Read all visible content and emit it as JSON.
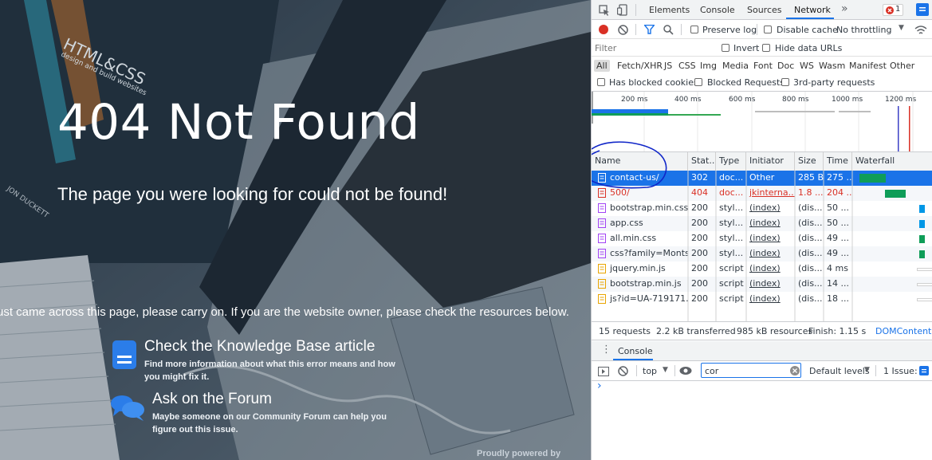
{
  "page": {
    "heading": "404 Not Found",
    "subheading": "The page you were looking for could not be found!",
    "message": "ust came across this page, please carry on. If you are the website owner, please check the resources below.",
    "book_text": [
      "HTML&CSS",
      "design and build websites",
      "JON DUCKETT"
    ],
    "help": [
      {
        "title": "Check the Knowledge Base article",
        "description": "Find more information about what this error means and how you might fix it.",
        "icon": "document-icon"
      },
      {
        "title": "Ask on the Forum",
        "description": "Maybe someone on our Community Forum can help you figure out this issue.",
        "icon": "chat-bubbles-icon"
      }
    ],
    "footer": "Proudly powered by"
  },
  "devtools": {
    "tabs": [
      "Elements",
      "Console",
      "Sources",
      "Network"
    ],
    "more_tabs": "»",
    "active_tab": "Network",
    "error_count": "1",
    "toolbar": {
      "preserve_log": "Preserve log",
      "disable_cache": "Disable cache",
      "throttling": "No throttling"
    },
    "filter": {
      "placeholder": "Filter",
      "invert": "Invert",
      "hide_data_urls": "Hide data URLs"
    },
    "filter_types": [
      "All",
      "Fetch/XHR",
      "JS",
      "CSS",
      "Img",
      "Media",
      "Font",
      "Doc",
      "WS",
      "Wasm",
      "Manifest",
      "Other"
    ],
    "filter_options": [
      "Has blocked cookies",
      "Blocked Requests",
      "3rd-party requests"
    ],
    "timeline_ticks": [
      "200 ms",
      "400 ms",
      "600 ms",
      "800 ms",
      "1000 ms",
      "1200 ms"
    ],
    "columns": [
      "Name",
      "Stat...",
      "Type",
      "Initiator",
      "Size",
      "Time",
      "Waterfall"
    ],
    "requests": [
      {
        "name": "contact-us/",
        "status": "302",
        "type": "doc...",
        "initiator": "Other",
        "size": "285 B",
        "time": "275 ...",
        "icon": "document-icon",
        "selected": true
      },
      {
        "name": "500/",
        "status": "404",
        "type": "doc...",
        "initiator": "jkinterna...",
        "size": "1.8 ...",
        "time": "204 ...",
        "icon": "document-icon",
        "error": true
      },
      {
        "name": "bootstrap.min.css",
        "status": "200",
        "type": "styl...",
        "initiator": "(index)",
        "size": "(dis...",
        "time": "50 ...",
        "icon": "stylesheet-icon"
      },
      {
        "name": "app.css",
        "status": "200",
        "type": "styl...",
        "initiator": "(index)",
        "size": "(dis...",
        "time": "50 ...",
        "icon": "stylesheet-icon"
      },
      {
        "name": "all.min.css",
        "status": "200",
        "type": "styl...",
        "initiator": "(index)",
        "size": "(dis...",
        "time": "49 ...",
        "icon": "stylesheet-icon"
      },
      {
        "name": "css?family=Monts...",
        "status": "200",
        "type": "styl...",
        "initiator": "(index)",
        "size": "(dis...",
        "time": "49 ...",
        "icon": "stylesheet-icon"
      },
      {
        "name": "jquery.min.js",
        "status": "200",
        "type": "script",
        "initiator": "(index)",
        "size": "(dis...",
        "time": "4 ms",
        "icon": "script-icon"
      },
      {
        "name": "bootstrap.min.js",
        "status": "200",
        "type": "script",
        "initiator": "(index)",
        "size": "(dis...",
        "time": "14 ...",
        "icon": "script-icon"
      },
      {
        "name": "js?id=UA-719171...",
        "status": "200",
        "type": "script",
        "initiator": "(index)",
        "size": "(dis...",
        "time": "18 ...",
        "icon": "script-icon"
      }
    ],
    "summary": [
      "15 requests",
      "2.2 kB transferred",
      "985 kB resources",
      "Finish: 1.15 s",
      "DOMContentLo"
    ],
    "drawer_tab": "Console",
    "console": {
      "context": "top",
      "filter_value": "cor",
      "levels": "Default levels",
      "issues": "1 Issue:",
      "prompt": "›"
    },
    "colors": {
      "accent": "#1a73e8",
      "error": "#d93025",
      "waterfall": "#0f9d58",
      "annotation": "#1026c8"
    }
  }
}
